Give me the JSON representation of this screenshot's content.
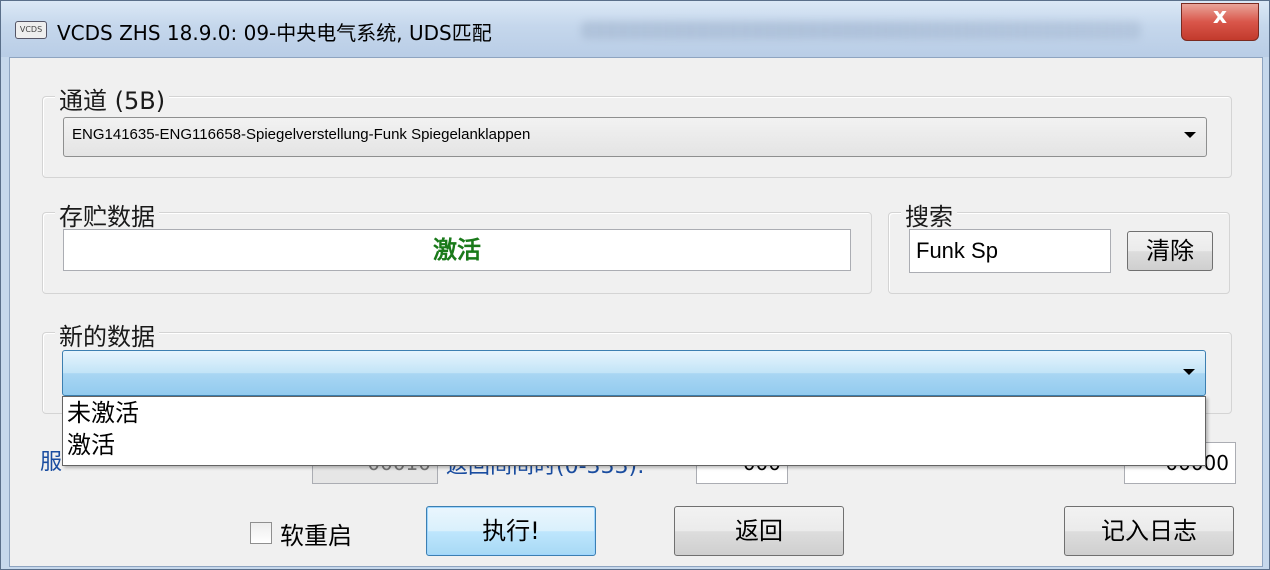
{
  "window": {
    "icon_text": "VCDS",
    "title": "VCDS ZHS 18.9.0: 09-中央电气系统,  UDS匹配",
    "close_glyph": "x"
  },
  "channel": {
    "legend": "通道 (5B)",
    "selected": "ENG141635-ENG116658-Spiegelverstellung-Funk Spiegelanklappen"
  },
  "stored": {
    "legend": "存贮数据",
    "value": "激活",
    "value_color": "#1a7a1a"
  },
  "search": {
    "legend": "搜索",
    "value": "Funk Sp",
    "clear_label": "清除"
  },
  "new_data": {
    "legend": "新的数据",
    "selected": "",
    "options": [
      "未激活",
      "激活"
    ]
  },
  "lower_row": {
    "label1_visible": "服",
    "field1_value": "00010",
    "label2_visible": "返回间间时(0-333):",
    "field2_value": "000",
    "field3_value": "00000"
  },
  "footer": {
    "soft_restart_label": "软重启",
    "soft_restart_checked": false,
    "execute_label": "执行!",
    "back_label": "返回",
    "log_label": "记入日志"
  }
}
